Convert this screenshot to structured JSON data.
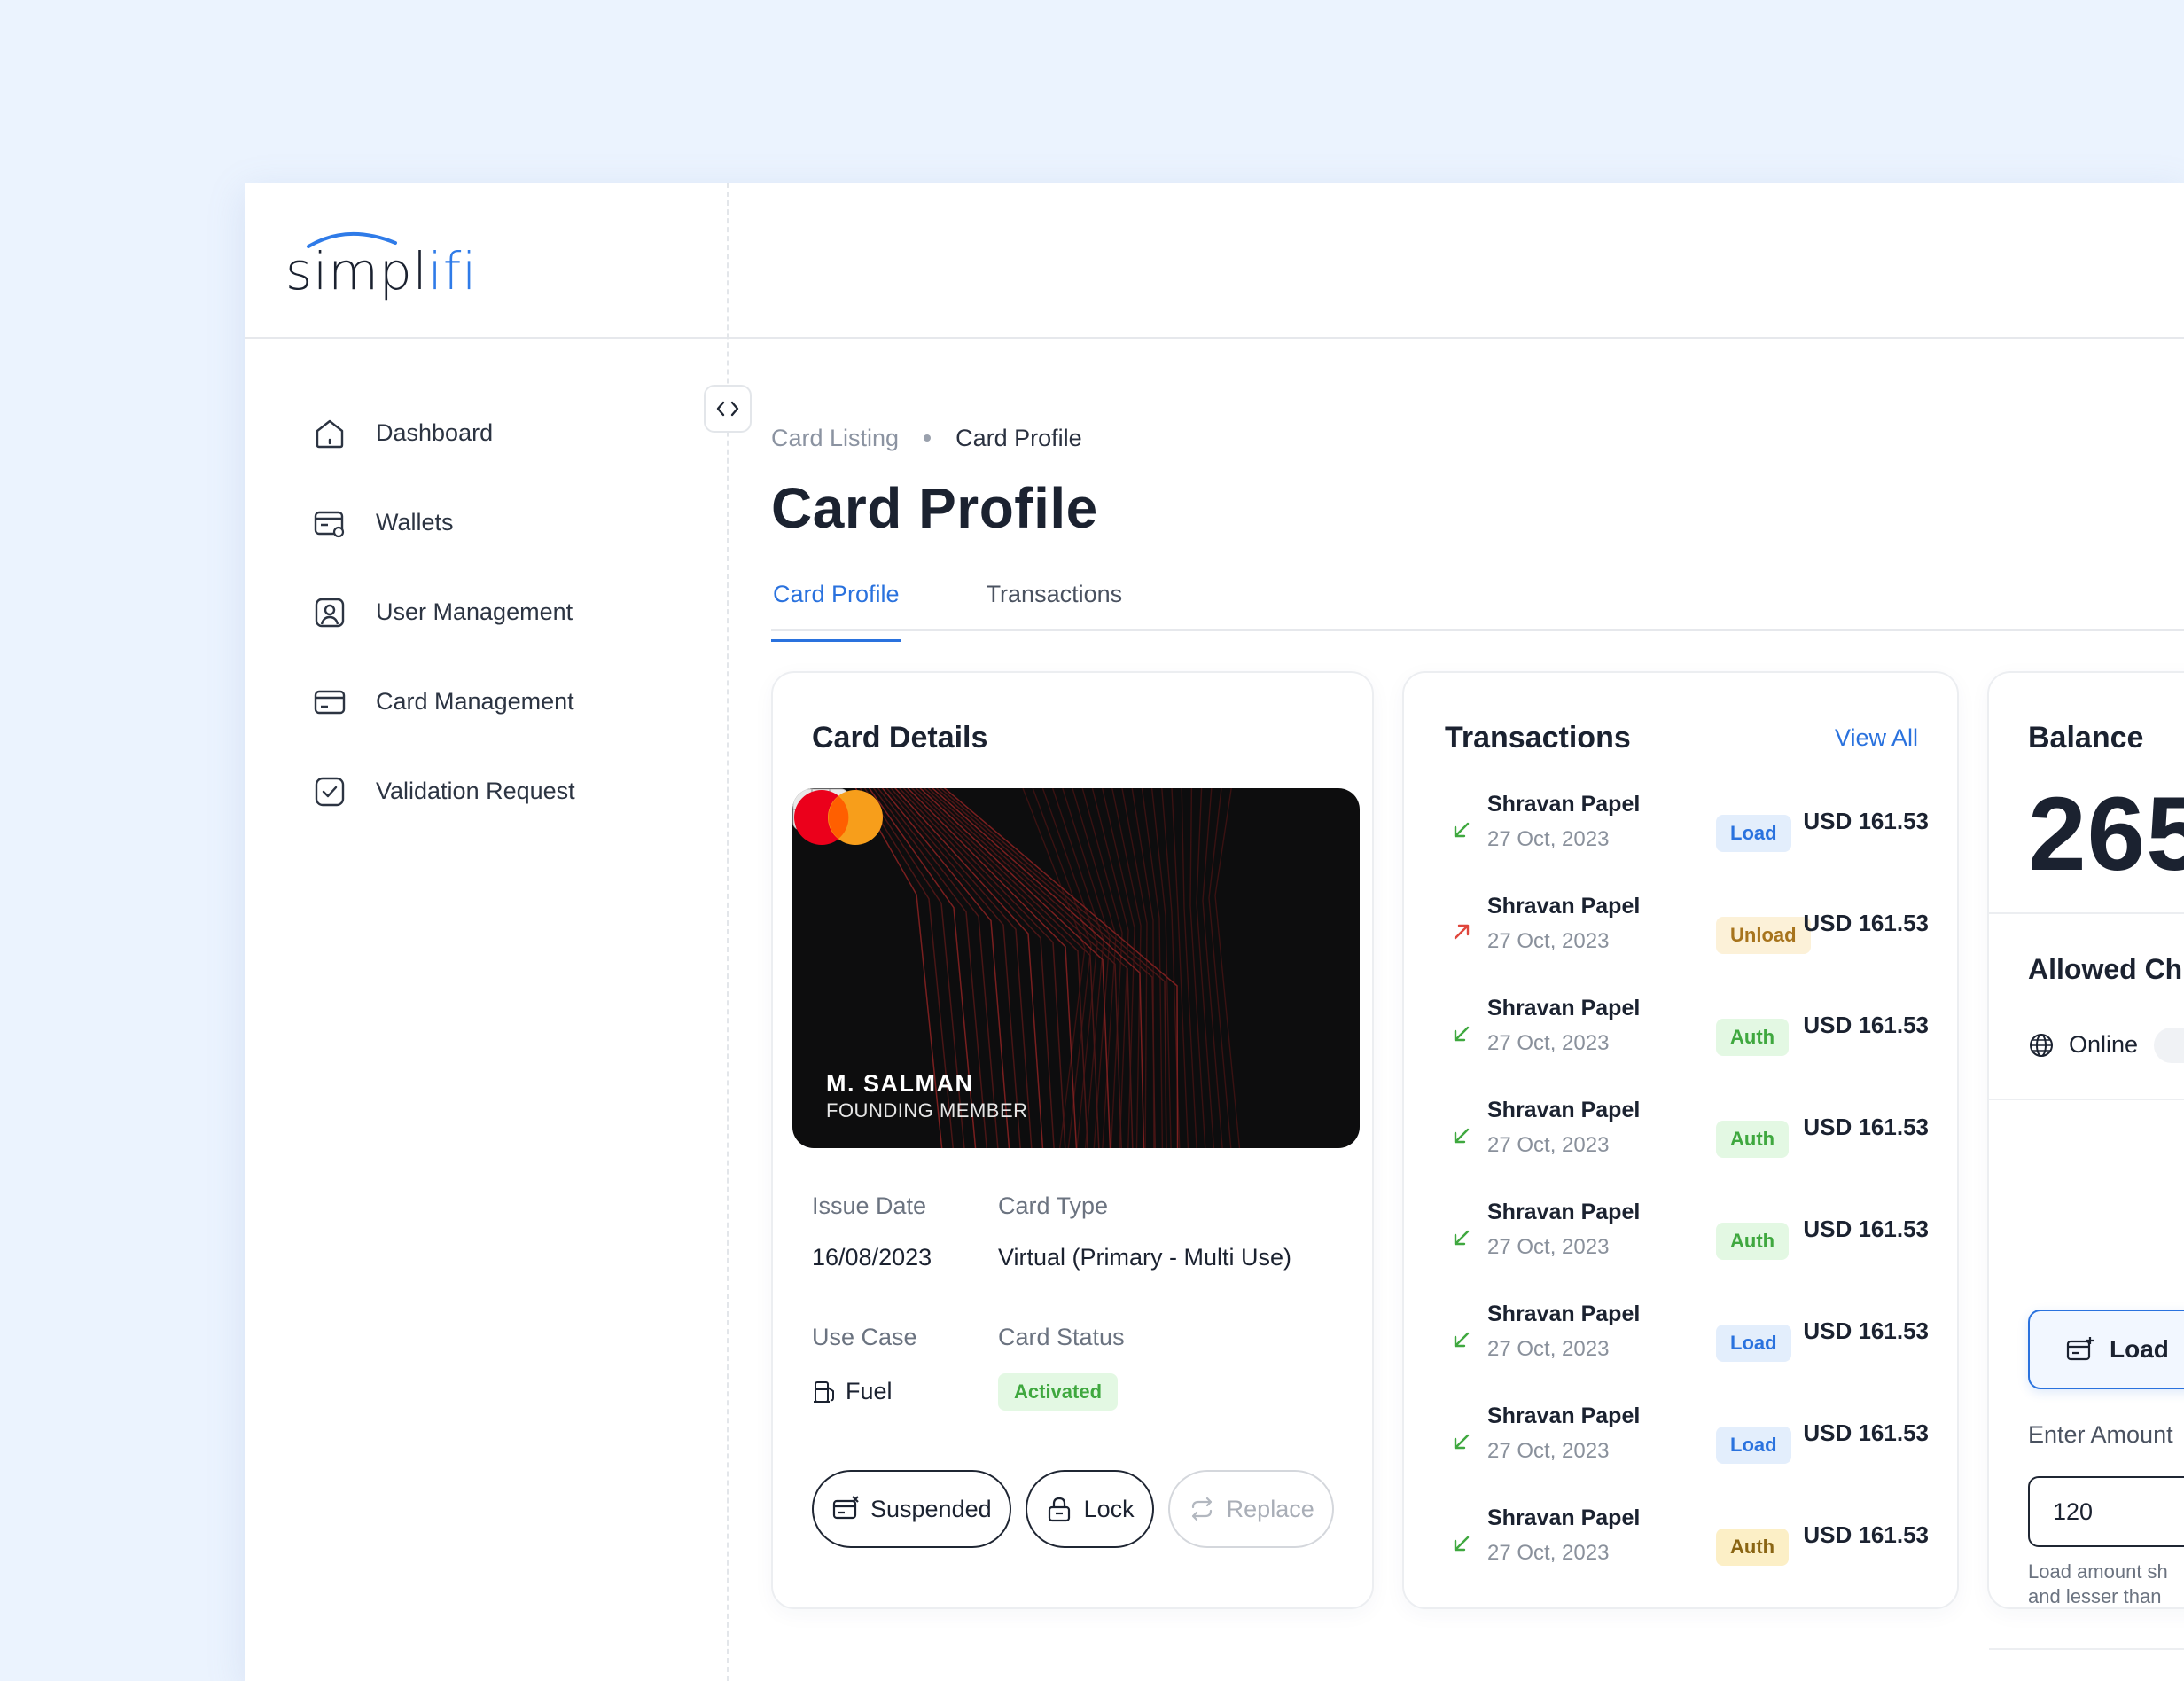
{
  "brand": {
    "name_main": "simpl",
    "name_accent": "ifi",
    "accent_color": "#2f7be8"
  },
  "sidebar": {
    "items": [
      {
        "label": "Dashboard",
        "icon": "home-icon"
      },
      {
        "label": "Wallets",
        "icon": "wallet-icon"
      },
      {
        "label": "User Management",
        "icon": "user-icon"
      },
      {
        "label": "Card Management",
        "icon": "credit-card-icon"
      },
      {
        "label": "Validation Request",
        "icon": "check-square-icon"
      }
    ]
  },
  "breadcrumb": {
    "parent": "Card Listing",
    "current": "Card Profile"
  },
  "page": {
    "title": "Card Profile",
    "tabs": [
      {
        "label": "Card Profile",
        "active": true
      },
      {
        "label": "Transactions",
        "active": false
      }
    ]
  },
  "card_details": {
    "heading": "Card Details",
    "card": {
      "holder": "M. SALMAN",
      "holder_title": "FOUNDING MEMBER",
      "network_icon": "mastercard-logo"
    },
    "issue_date_label": "Issue Date",
    "issue_date": "16/08/2023",
    "card_type_label": "Card Type",
    "card_type": "Virtual (Primary - Multi Use)",
    "use_case_label": "Use Case",
    "use_case": "Fuel",
    "status_label": "Card Status",
    "status": "Activated",
    "actions": {
      "suspend": "Suspended",
      "lock": "Lock",
      "replace": "Replace"
    }
  },
  "transactions": {
    "heading": "Transactions",
    "view_all": "View All",
    "items": [
      {
        "name": "Shravan Papel",
        "date": "27 Oct, 2023",
        "type": "Load",
        "amount": "USD 161.53",
        "direction": "in"
      },
      {
        "name": "Shravan Papel",
        "date": "27 Oct, 2023",
        "type": "Unload",
        "amount": "USD 161.53",
        "direction": "out"
      },
      {
        "name": "Shravan Papel",
        "date": "27 Oct, 2023",
        "type": "Auth",
        "amount": "USD 161.53",
        "direction": "in"
      },
      {
        "name": "Shravan Papel",
        "date": "27 Oct, 2023",
        "type": "Auth",
        "amount": "USD 161.53",
        "direction": "in"
      },
      {
        "name": "Shravan Papel",
        "date": "27 Oct, 2023",
        "type": "Auth",
        "amount": "USD 161.53",
        "direction": "in"
      },
      {
        "name": "Shravan Papel",
        "date": "27 Oct, 2023",
        "type": "Load",
        "amount": "USD 161.53",
        "direction": "in"
      },
      {
        "name": "Shravan Papel",
        "date": "27 Oct, 2023",
        "type": "Load",
        "amount": "USD 161.53",
        "direction": "in"
      },
      {
        "name": "Shravan Papel",
        "date": "27 Oct, 2023",
        "type": "Auth",
        "amount": "USD 161.53",
        "direction": "in"
      }
    ]
  },
  "balance": {
    "heading": "Balance",
    "value": "265",
    "allowed_heading": "Allowed Ch",
    "channel_online": "Online",
    "load_button": "Load",
    "amount_label": "Enter Amount",
    "amount_value": "120",
    "amount_help_1": "Load amount sh",
    "amount_help_2": "and lesser than"
  }
}
